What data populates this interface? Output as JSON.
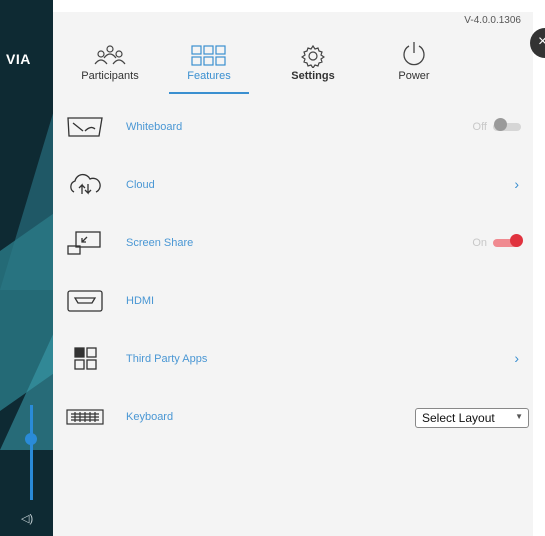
{
  "app": {
    "logo": "VIA",
    "version": "V-4.0.0.1306",
    "close_glyph": "×"
  },
  "tabs": [
    {
      "label": "Participants",
      "icon": "participants-icon",
      "active": false
    },
    {
      "label": "Features",
      "icon": "features-grid-icon",
      "active": true
    },
    {
      "label": "Settings",
      "icon": "gear-icon",
      "active": false
    },
    {
      "label": "Power",
      "icon": "power-icon",
      "active": false
    }
  ],
  "features": [
    {
      "label": "Whiteboard",
      "icon": "whiteboard-icon",
      "control": "toggle",
      "state": "Off"
    },
    {
      "label": "Cloud",
      "icon": "cloud-icon",
      "control": "chevron",
      "chevron": "›"
    },
    {
      "label": "Screen Share",
      "icon": "screen-share-icon",
      "control": "toggle",
      "state": "On"
    },
    {
      "label": "HDMI",
      "icon": "hdmi-icon"
    },
    {
      "label": "Third Party Apps",
      "icon": "apps-grid-icon",
      "control": "chevron",
      "chevron": "›"
    },
    {
      "label": "Keyboard",
      "icon": "keyboard-icon",
      "control": "select",
      "selected": "Select Layout"
    }
  ],
  "volume": {
    "level": 0.7,
    "icon": "speaker-icon",
    "glyph": "◁)"
  },
  "colors": {
    "accent": "#3a8fd0",
    "toggle_on": "#e0323e",
    "toggle_off": "#c9c9c9",
    "sidebar": "#0e2a33"
  }
}
